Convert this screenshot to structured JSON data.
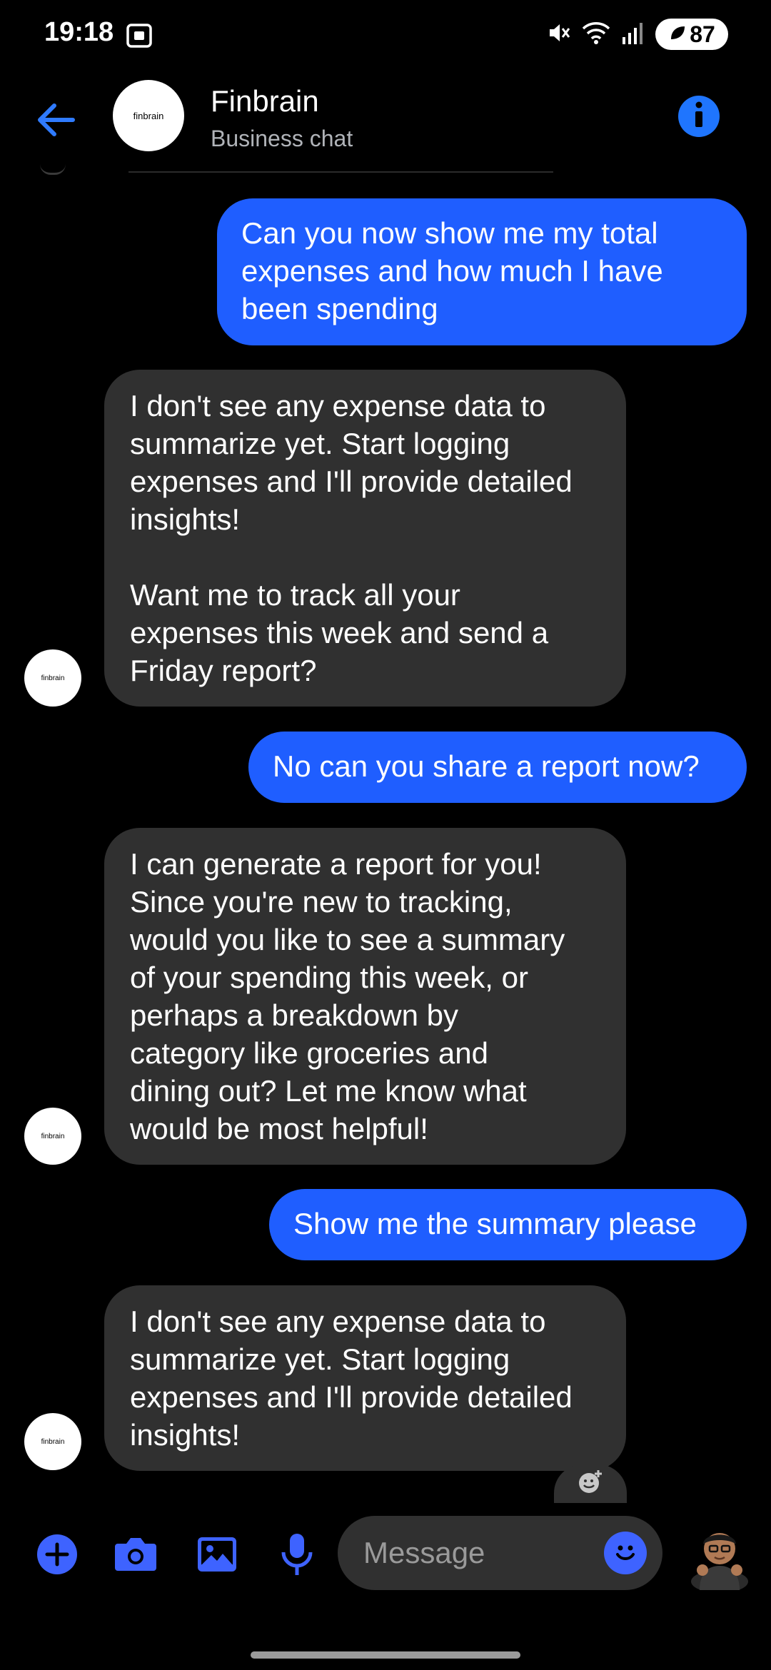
{
  "status_bar": {
    "time": "19:18",
    "battery": "87"
  },
  "header": {
    "name": "Finbrain",
    "subtitle": "Business chat",
    "avatar_text": "finbrain"
  },
  "messages": [
    {
      "side": "out",
      "text": "Can you now show me my total\nexpenses and how much I  have\nbeen spending"
    },
    {
      "side": "in",
      "text": "I don't see any expense data to\nsummarize yet. Start logging\nexpenses and I'll provide detailed\ninsights!\n\nWant me to track all your\nexpenses this week and send a\nFriday report?"
    },
    {
      "side": "out",
      "text": "No can you share a report now?"
    },
    {
      "side": "in",
      "text": "I can generate a report for you!\nSince you're new to tracking,\nwould you like to see a summary\nof your spending this week, or\nperhaps a breakdown by\ncategory like groceries and\ndining out? Let me know what\nwould be most helpful!"
    },
    {
      "side": "out",
      "text": "Show me the summary please"
    },
    {
      "side": "in",
      "text": "I don't see any expense data to\nsummarize yet. Start logging\nexpenses and I'll provide detailed\ninsights!"
    }
  ],
  "composer": {
    "placeholder": "Message"
  },
  "colors": {
    "accent": "#1f5eff",
    "incoming_bubble": "#303030",
    "background": "#000000"
  }
}
